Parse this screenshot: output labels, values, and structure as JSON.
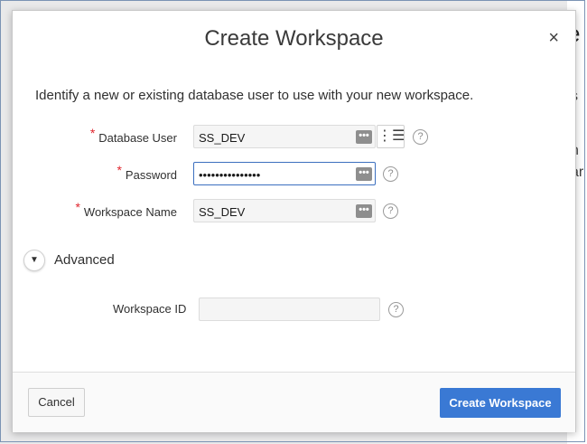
{
  "background": {
    "title_fragment": "e",
    "text_fragments": [
      "s",
      "n",
      "ar"
    ]
  },
  "dialog": {
    "title": "Create Workspace",
    "close_glyph": "×",
    "intro": "Identify a new or existing database user to use with your new workspace.",
    "required_marker": "*",
    "fields": {
      "database_user": {
        "label": "Database User",
        "value": "SS_DEV"
      },
      "password": {
        "label": "Password",
        "value": "•••••••••••••••"
      },
      "workspace_name": {
        "label": "Workspace Name",
        "value": "SS_DEV"
      }
    },
    "dots_glyph": "•••",
    "list_glyph": "⋮☰",
    "help_glyph": "?",
    "advanced": {
      "label": "Advanced",
      "toggle_glyph": "▼"
    },
    "workspace_id": {
      "label": "Workspace ID",
      "value": ""
    },
    "footer": {
      "cancel_label": "Cancel",
      "create_label": "Create Workspace"
    }
  }
}
